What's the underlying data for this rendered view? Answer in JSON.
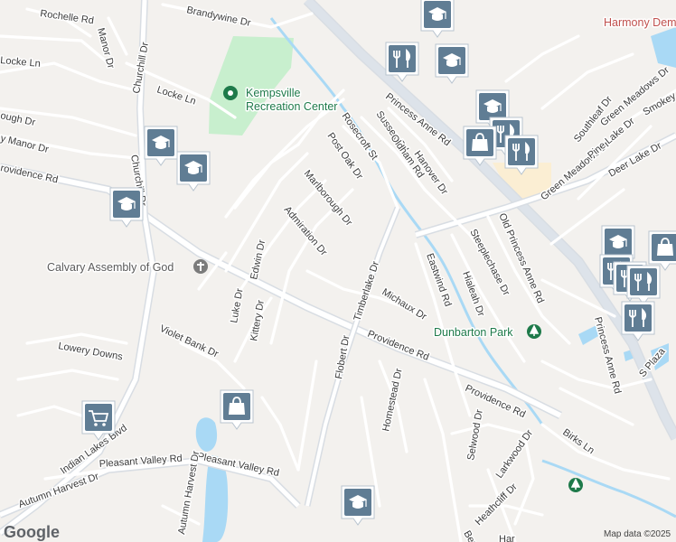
{
  "map": {
    "labels": {
      "roads": [
        "Rochelle Rd",
        "Manor Dr",
        "Locke Ln",
        "Locke Ln",
        "Brandywine Dr",
        "Churchill Dr",
        "Churchill Dr",
        "ough Dr",
        "y Manor Dr",
        "rovidence Rd",
        "Indian Lakes Blvd",
        "Pleasant Valley Rd",
        "Pleasant Valley Rd",
        "Autumn Harvest Dr",
        "Autumn Harvest Dr",
        "Edwin Dr",
        "Luke Dr",
        "Kittery Dr",
        "Violet Bank Dr",
        "Lowery Downs",
        "Admiration Dr",
        "Marlborough Dr",
        "Post Oak Dr",
        "Rosecroft St",
        "Sussex Rd",
        "Oldham Rd",
        "Hanover Dr",
        "Princess Anne Rd",
        "Princess Anne Rd",
        "Timberlake Dr",
        "Flobert Dr",
        "Michaux Dr",
        "Providence Rd",
        "Providence Rd",
        "Homestead Dr",
        "Eastwind Rd",
        "Hialeah Dr",
        "Steeplechase Dr",
        "Old Princess Anne Rd",
        "Selwood Dr",
        "Larkwood Dr",
        "Heathcliff Dr",
        "Berry",
        "Har",
        "Birks Ln",
        "Green Meadows Dr",
        "Green Meadows Dr",
        "Southleaf Dr",
        "Pine Lake Dr",
        "Deer Lake Dr",
        "Smokey",
        "S Plaza"
      ],
      "places": [
        {
          "name": "Kempsville Recreation Center",
          "line1": "Kempsville",
          "line2": "Recreation Center",
          "color": "#1e7a4a"
        },
        {
          "name": "Calvary Assembly of God",
          "color": "#5a5a5a"
        },
        {
          "name": "Dunbarton Park",
          "color": "#1e7a4a"
        },
        {
          "name": "Harmony Dem",
          "color": "#c0504d"
        }
      ]
    },
    "markers": [
      {
        "kind": "school",
        "icon": "graduation-cap-icon"
      },
      {
        "kind": "school",
        "icon": "graduation-cap-icon"
      },
      {
        "kind": "school",
        "icon": "graduation-cap-icon"
      },
      {
        "kind": "school",
        "icon": "graduation-cap-icon"
      },
      {
        "kind": "school",
        "icon": "graduation-cap-icon"
      },
      {
        "kind": "school",
        "icon": "graduation-cap-icon"
      },
      {
        "kind": "school",
        "icon": "graduation-cap-icon"
      },
      {
        "kind": "school",
        "icon": "graduation-cap-icon"
      },
      {
        "kind": "restaurant",
        "icon": "fork-knife-icon"
      },
      {
        "kind": "restaurant",
        "icon": "fork-knife-icon"
      },
      {
        "kind": "restaurant",
        "icon": "fork-knife-icon"
      },
      {
        "kind": "restaurant",
        "icon": "fork-knife-icon"
      },
      {
        "kind": "restaurant",
        "icon": "fork-knife-icon"
      },
      {
        "kind": "restaurant",
        "icon": "fork-knife-icon"
      },
      {
        "kind": "restaurant",
        "icon": "fork-knife-icon"
      },
      {
        "kind": "shopping",
        "icon": "shopping-bag-icon"
      },
      {
        "kind": "shopping",
        "icon": "shopping-bag-icon"
      },
      {
        "kind": "shopping",
        "icon": "shopping-bag-icon"
      },
      {
        "kind": "grocery",
        "icon": "shopping-cart-icon"
      }
    ],
    "attribution": {
      "logo": "Google",
      "text": "Map data ©2025"
    },
    "colors": {
      "background": "#f3f1ee",
      "road": "#ffffff",
      "road_casing": "#d8dde3",
      "major_road": "#dde3ea",
      "park": "#c8efce",
      "water": "#a9d9f5",
      "commercial": "#fbeed3",
      "marker": "#607d94",
      "marker_dark": "#4e6b80"
    }
  }
}
